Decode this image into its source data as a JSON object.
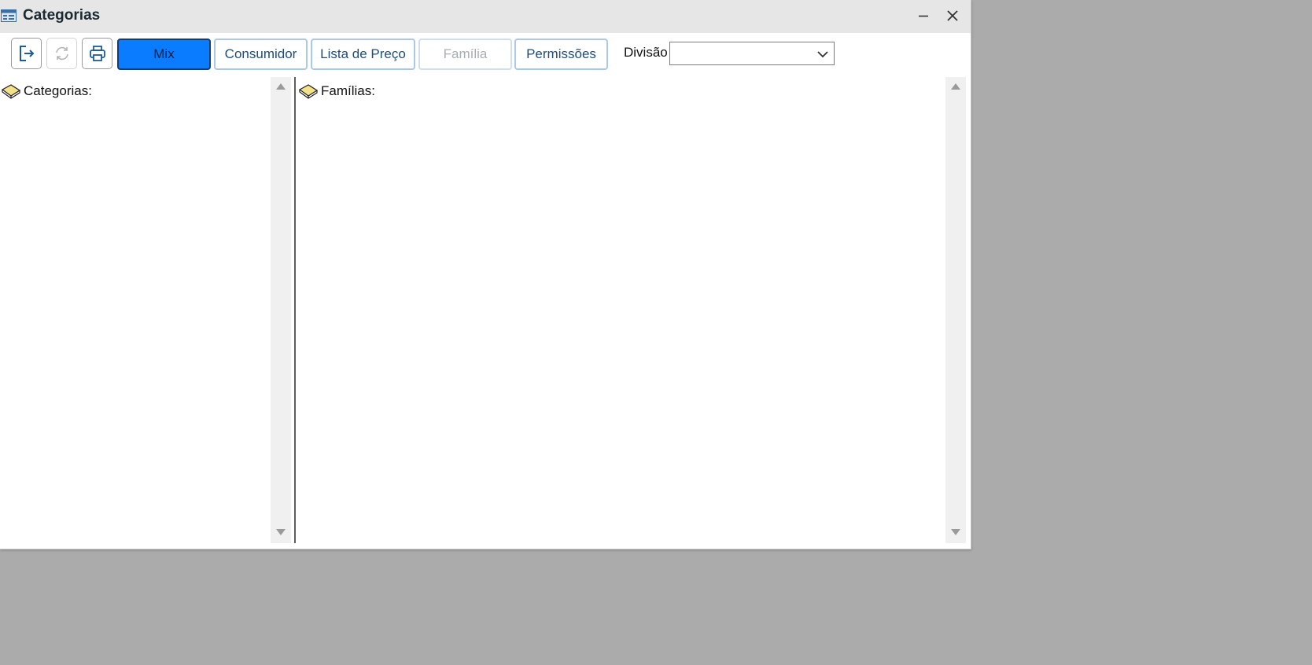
{
  "window": {
    "title": "Categorias",
    "icon": "form-window-icon"
  },
  "toolbar": {
    "icons": [
      "exit-icon",
      "refresh-icon",
      "print-icon"
    ],
    "tabs": [
      {
        "label": "Mix",
        "state": "active"
      },
      {
        "label": "Consumidor",
        "state": "normal"
      },
      {
        "label": "Lista de Preço",
        "state": "normal"
      },
      {
        "label": "Família",
        "state": "disabled"
      },
      {
        "label": "Permissões",
        "state": "normal"
      }
    ],
    "division_label": "Divisão",
    "division_value": ""
  },
  "left_pane": {
    "root_label": "Categorias:",
    "icon": "book-icon"
  },
  "right_pane": {
    "root_label": "Famílias:",
    "icon": "book-icon"
  },
  "colors": {
    "active_tab_bg": "#0a7cff",
    "active_tab_border": "#0d3d7a",
    "tab_border": "#a9c8ea",
    "tab_text": "#1f4d7a",
    "disabled_text": "#a7aeb5",
    "titlebar_bg": "#e6e6e6",
    "desktop_bg": "#ababab"
  }
}
